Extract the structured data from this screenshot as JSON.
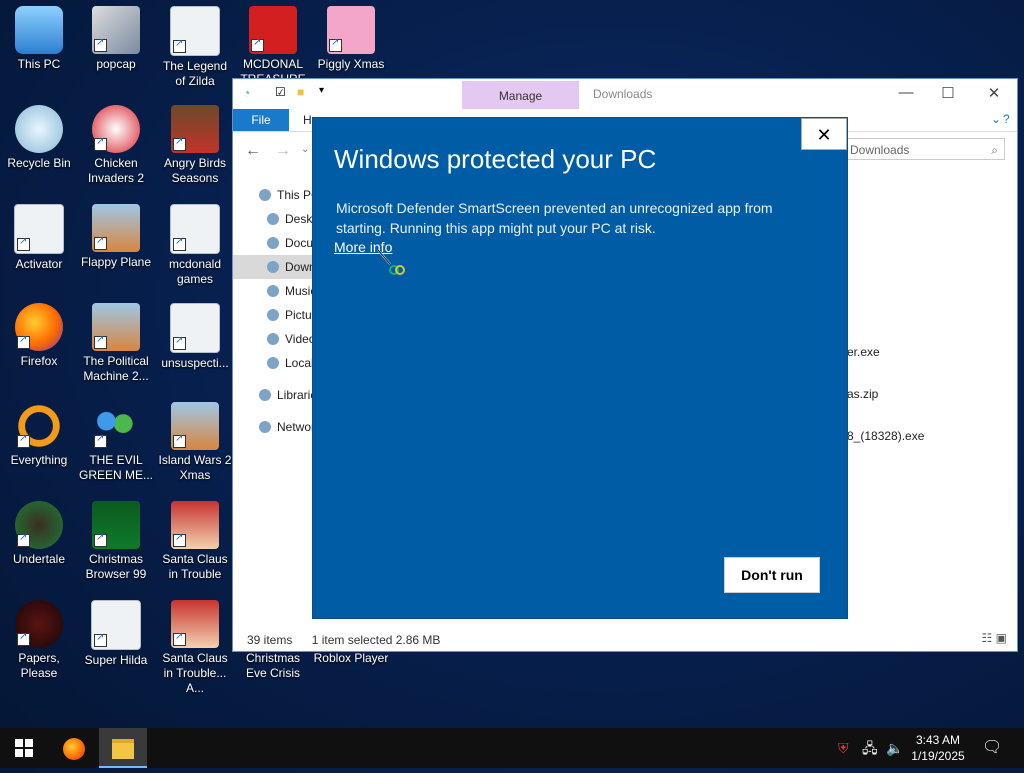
{
  "desktop_icons": [
    {
      "label": "This PC",
      "icon": "computer-icon"
    },
    {
      "label": "popcap",
      "icon": "app-icon"
    },
    {
      "label": "The Legend of Zilda",
      "icon": "file-icon"
    },
    {
      "label": "MCDONAL TREASURE",
      "icon": "mcdonalds-icon"
    },
    {
      "label": "Piggly Xmas",
      "icon": "pig-icon"
    },
    {
      "label": "Recycle Bin",
      "icon": "recycle-bin-icon"
    },
    {
      "label": "Chicken Invaders 2",
      "icon": "chicken-icon"
    },
    {
      "label": "Angry Birds Seasons",
      "icon": "angry-birds-icon"
    },
    {
      "label": "Activator",
      "icon": "file-icon"
    },
    {
      "label": "Flappy Plane",
      "icon": "game-icon"
    },
    {
      "label": "mcdonald games",
      "icon": "file-icon"
    },
    {
      "label": "Firefox",
      "icon": "firefox-icon"
    },
    {
      "label": "The Political Machine 2...",
      "icon": "game-icon"
    },
    {
      "label": "unsuspecti...",
      "icon": "file-icon"
    },
    {
      "label": "Everything",
      "icon": "search-app-icon"
    },
    {
      "label": "THE EVIL GREEN ME...",
      "icon": "messenger-icon"
    },
    {
      "label": "Island Wars 2 Xmas",
      "icon": "game-icon"
    },
    {
      "label": "Undertale",
      "icon": "undertale-icon"
    },
    {
      "label": "Christmas Browser 99",
      "icon": "tree-icon"
    },
    {
      "label": "Santa Claus in Trouble",
      "icon": "santa-icon"
    },
    {
      "label": "Papers, Please",
      "icon": "papers-icon"
    },
    {
      "label": "Super Hilda",
      "icon": "file-icon"
    },
    {
      "label": "Santa Claus in Trouble... A...",
      "icon": "santa-icon"
    },
    {
      "label": "Christmas Eve Crisis",
      "icon": "game-icon"
    },
    {
      "label": "Roblox Player",
      "icon": "roblox-icon"
    }
  ],
  "explorer": {
    "manage_tab": "Manage",
    "title": "Downloads",
    "file_tab": "File",
    "home_tab": "Ho",
    "search_placeholder": "Downloads",
    "tree": [
      "This PC",
      "Desktop",
      "Documents",
      "Downloads",
      "Music",
      "Pictures",
      "Videos",
      "Local Disk",
      "Libraries",
      "Network"
    ],
    "files": [
      "er.exe",
      "as.zip",
      "8_(18328).exe"
    ],
    "status_items": "39 items",
    "status_selected": "1 item selected  2.86 MB"
  },
  "dialog": {
    "title": "Windows protected your PC",
    "message": "Microsoft Defender SmartScreen prevented an unrecognized app from starting. Running this app might put your PC at risk.",
    "more_info": "More info",
    "dont_run": "Don't run",
    "close_glyph": "✕"
  },
  "taskbar": {
    "time": "3:43 AM",
    "date": "1/19/2025"
  }
}
